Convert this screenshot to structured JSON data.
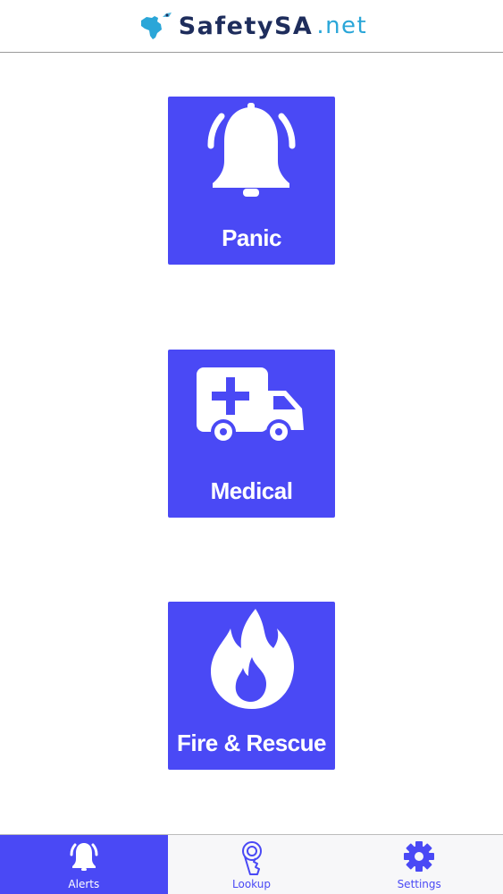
{
  "header": {
    "logo_main": "SafetySA",
    "logo_tld": ".net"
  },
  "colors": {
    "accent": "#4a49f5",
    "logo_dark": "#1e2d5c",
    "logo_light": "#2aa6d8"
  },
  "tiles": [
    {
      "label": "Panic",
      "icon": "bell-icon"
    },
    {
      "label": "Medical",
      "icon": "ambulance-icon"
    },
    {
      "label": "Fire & Rescue",
      "icon": "fire-icon"
    }
  ],
  "nav": {
    "active": "Alerts",
    "items": [
      {
        "label": "Alerts",
        "icon": "bell-icon"
      },
      {
        "label": "Lookup",
        "icon": "key-icon"
      },
      {
        "label": "Settings",
        "icon": "gear-icon"
      }
    ]
  }
}
